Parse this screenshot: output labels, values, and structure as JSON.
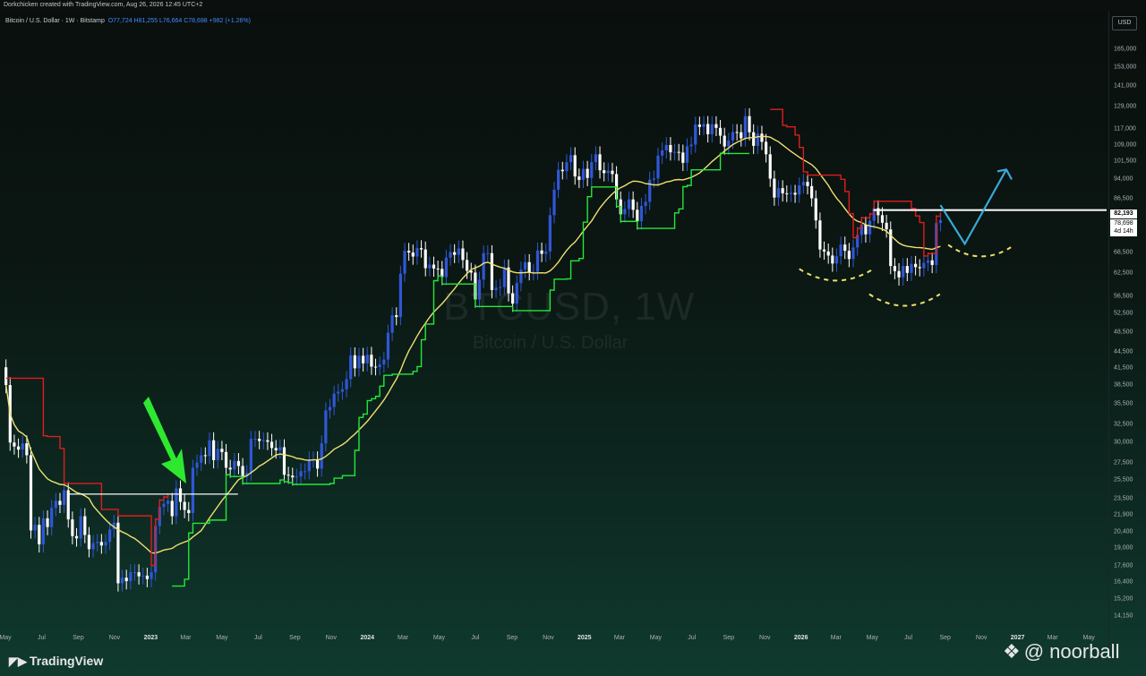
{
  "header": {
    "text": "Dorkchicken created with TradingView.com, Aug 26, 2026 12:45 UTC+2"
  },
  "symbol": {
    "title": "Bitcoin / U.S. Dollar · 1W · Bitstamp",
    "ohlc": "O77,724 H81,255 L76,664 C78,698 +982 (+1.26%)"
  },
  "watermark": {
    "ticker": "BTCUSD, 1W",
    "name": "Bitcoin / U.S. Dollar"
  },
  "axis": {
    "currency": "USD"
  },
  "price_labels": {
    "level": "82,193",
    "last": "78,698",
    "countdown": "4d 14h"
  },
  "footer": {
    "brand": "TradingView",
    "handle": "@ noorball"
  },
  "colors": {
    "bull": "#2f57d8",
    "bear": "#ffffff",
    "ma": "#f0e070",
    "support": "#22e83a",
    "resistance": "#e01d1d",
    "projection": "#3aa8d6",
    "arrow": "#2ee830"
  },
  "chart_data": {
    "type": "candlestick",
    "title": "Bitcoin / U.S. Dollar · 1W · Bitstamp",
    "y_scale": "log",
    "y_ticks": [
      14150,
      15200,
      16400,
      17600,
      19000,
      20400,
      21900,
      23500,
      25500,
      27500,
      30000,
      32500,
      35500,
      38500,
      41500,
      44500,
      48500,
      52500,
      56500,
      62500,
      68500,
      75500,
      86500,
      94000,
      101500,
      109000,
      117000,
      129000,
      141000,
      153000,
      165000
    ],
    "x_ticks": [
      "May",
      "Jul",
      "Sep",
      "Nov",
      "2023",
      "Mar",
      "May",
      "Jul",
      "Sep",
      "Nov",
      "2024",
      "Mar",
      "May",
      "Jul",
      "Sep",
      "Nov",
      "2025",
      "Mar",
      "May",
      "Jul",
      "Sep",
      "Nov",
      "2026",
      "Mar",
      "May",
      "Jul",
      "Sep",
      "Nov",
      "2027",
      "Mar",
      "May"
    ],
    "x_range": [
      "2022-05-01",
      "2027-05-31"
    ],
    "y_range": [
      13500,
      175000
    ],
    "key_levels": [
      {
        "value": 24000,
        "from": "2022-08-14",
        "to": "2023-05-28"
      },
      {
        "value": 82193,
        "from": "2026-05-03",
        "to": "2027-05-31"
      }
    ],
    "candles_weekly_close": [
      {
        "date": "2022-05-02",
        "close": 38500
      },
      {
        "date": "2022-05-09",
        "close": 30000
      },
      {
        "date": "2022-05-16",
        "close": 29500
      },
      {
        "date": "2022-05-23",
        "close": 29100
      },
      {
        "date": "2022-05-30",
        "close": 29900
      },
      {
        "date": "2022-06-06",
        "close": 28400
      },
      {
        "date": "2022-06-13",
        "close": 20500
      },
      {
        "date": "2022-06-20",
        "close": 21000
      },
      {
        "date": "2022-06-27",
        "close": 19300
      },
      {
        "date": "2022-07-04",
        "close": 21600
      },
      {
        "date": "2022-07-11",
        "close": 20800
      },
      {
        "date": "2022-07-18",
        "close": 22600
      },
      {
        "date": "2022-07-25",
        "close": 23300
      },
      {
        "date": "2022-08-01",
        "close": 22900
      },
      {
        "date": "2022-08-08",
        "close": 24400
      },
      {
        "date": "2022-08-15",
        "close": 21500
      },
      {
        "date": "2022-08-22",
        "close": 20000
      },
      {
        "date": "2022-08-29",
        "close": 19800
      },
      {
        "date": "2022-09-05",
        "close": 21800
      },
      {
        "date": "2022-09-12",
        "close": 20100
      },
      {
        "date": "2022-09-19",
        "close": 18900
      },
      {
        "date": "2022-09-26",
        "close": 19400
      },
      {
        "date": "2022-10-03",
        "close": 19500
      },
      {
        "date": "2022-10-10",
        "close": 19200
      },
      {
        "date": "2022-10-17",
        "close": 19500
      },
      {
        "date": "2022-10-24",
        "close": 20600
      },
      {
        "date": "2022-10-31",
        "close": 21200
      },
      {
        "date": "2022-11-07",
        "close": 16300
      },
      {
        "date": "2022-11-14",
        "close": 16700
      },
      {
        "date": "2022-11-21",
        "close": 16450
      },
      {
        "date": "2022-11-28",
        "close": 17100
      },
      {
        "date": "2022-12-05",
        "close": 17100
      },
      {
        "date": "2022-12-12",
        "close": 16800
      },
      {
        "date": "2022-12-19",
        "close": 16850
      },
      {
        "date": "2022-12-26",
        "close": 16600
      },
      {
        "date": "2023-01-02",
        "close": 17100
      },
      {
        "date": "2023-01-09",
        "close": 20900
      },
      {
        "date": "2023-01-16",
        "close": 22700
      },
      {
        "date": "2023-01-23",
        "close": 23000
      },
      {
        "date": "2023-01-30",
        "close": 23300
      },
      {
        "date": "2023-02-06",
        "close": 21800
      },
      {
        "date": "2023-02-13",
        "close": 24600
      },
      {
        "date": "2023-02-20",
        "close": 23200
      },
      {
        "date": "2023-02-27",
        "close": 22400
      },
      {
        "date": "2023-03-06",
        "close": 22100
      },
      {
        "date": "2023-03-13",
        "close": 26900
      },
      {
        "date": "2023-03-20",
        "close": 27500
      },
      {
        "date": "2023-03-27",
        "close": 28400
      },
      {
        "date": "2023-04-03",
        "close": 28300
      },
      {
        "date": "2023-04-10",
        "close": 30300
      },
      {
        "date": "2023-04-17",
        "close": 27800
      },
      {
        "date": "2023-04-24",
        "close": 29200
      },
      {
        "date": "2023-05-01",
        "close": 28800
      },
      {
        "date": "2023-05-08",
        "close": 26900
      },
      {
        "date": "2023-05-15",
        "close": 26700
      },
      {
        "date": "2023-05-22",
        "close": 27700
      },
      {
        "date": "2023-05-29",
        "close": 27100
      },
      {
        "date": "2023-06-05",
        "close": 25900
      },
      {
        "date": "2023-06-12",
        "close": 26300
      },
      {
        "date": "2023-06-19",
        "close": 30500
      },
      {
        "date": "2023-06-26",
        "close": 30500
      },
      {
        "date": "2023-07-03",
        "close": 30200
      },
      {
        "date": "2023-07-10",
        "close": 30300
      },
      {
        "date": "2023-07-17",
        "close": 30100
      },
      {
        "date": "2023-07-24",
        "close": 29300
      },
      {
        "date": "2023-07-31",
        "close": 29000
      },
      {
        "date": "2023-08-07",
        "close": 29400
      },
      {
        "date": "2023-08-14",
        "close": 26100
      },
      {
        "date": "2023-08-21",
        "close": 26000
      },
      {
        "date": "2023-08-28",
        "close": 25800
      },
      {
        "date": "2023-09-04",
        "close": 25900
      },
      {
        "date": "2023-09-11",
        "close": 26500
      },
      {
        "date": "2023-09-18",
        "close": 26500
      },
      {
        "date": "2023-09-25",
        "close": 27900
      },
      {
        "date": "2023-10-02",
        "close": 27900
      },
      {
        "date": "2023-10-09",
        "close": 26800
      },
      {
        "date": "2023-10-16",
        "close": 29900
      },
      {
        "date": "2023-10-23",
        "close": 34500
      },
      {
        "date": "2023-10-30",
        "close": 35000
      },
      {
        "date": "2023-11-06",
        "close": 37100
      },
      {
        "date": "2023-11-13",
        "close": 37400
      },
      {
        "date": "2023-11-20",
        "close": 37800
      },
      {
        "date": "2023-11-27",
        "close": 39500
      },
      {
        "date": "2023-12-04",
        "close": 43800
      },
      {
        "date": "2023-12-11",
        "close": 41400
      },
      {
        "date": "2023-12-18",
        "close": 43700
      },
      {
        "date": "2023-12-25",
        "close": 42300
      },
      {
        "date": "2024-01-01",
        "close": 43900
      },
      {
        "date": "2024-01-08",
        "close": 41700
      },
      {
        "date": "2024-01-15",
        "close": 41600
      },
      {
        "date": "2024-01-22",
        "close": 42100
      },
      {
        "date": "2024-01-29",
        "close": 43000
      },
      {
        "date": "2024-02-05",
        "close": 48300
      },
      {
        "date": "2024-02-12",
        "close": 52100
      },
      {
        "date": "2024-02-19",
        "close": 51700
      },
      {
        "date": "2024-02-26",
        "close": 62400
      },
      {
        "date": "2024-03-04",
        "close": 68900
      },
      {
        "date": "2024-03-11",
        "close": 68400
      },
      {
        "date": "2024-03-18",
        "close": 67200
      },
      {
        "date": "2024-03-25",
        "close": 69700
      },
      {
        "date": "2024-04-01",
        "close": 69300
      },
      {
        "date": "2024-04-08",
        "close": 63900
      },
      {
        "date": "2024-04-15",
        "close": 64900
      },
      {
        "date": "2024-04-22",
        "close": 63800
      },
      {
        "date": "2024-04-29",
        "close": 63700
      },
      {
        "date": "2024-05-06",
        "close": 61500
      },
      {
        "date": "2024-05-13",
        "close": 66900
      },
      {
        "date": "2024-05-20",
        "close": 68500
      },
      {
        "date": "2024-05-27",
        "close": 67700
      },
      {
        "date": "2024-06-03",
        "close": 69600
      },
      {
        "date": "2024-06-10",
        "close": 66200
      },
      {
        "date": "2024-06-17",
        "close": 63200
      },
      {
        "date": "2024-06-24",
        "close": 62700
      },
      {
        "date": "2024-07-01",
        "close": 55800
      },
      {
        "date": "2024-07-08",
        "close": 60800
      },
      {
        "date": "2024-07-15",
        "close": 68200
      },
      {
        "date": "2024-07-22",
        "close": 68200
      },
      {
        "date": "2024-07-29",
        "close": 58100
      },
      {
        "date": "2024-08-05",
        "close": 58700
      },
      {
        "date": "2024-08-12",
        "close": 58900
      },
      {
        "date": "2024-08-19",
        "close": 64100
      },
      {
        "date": "2024-08-26",
        "close": 57300
      },
      {
        "date": "2024-09-02",
        "close": 54800
      },
      {
        "date": "2024-09-09",
        "close": 59900
      },
      {
        "date": "2024-09-16",
        "close": 63500
      },
      {
        "date": "2024-09-23",
        "close": 65600
      },
      {
        "date": "2024-09-30",
        "close": 62800
      },
      {
        "date": "2024-10-07",
        "close": 62900
      },
      {
        "date": "2024-10-14",
        "close": 69000
      },
      {
        "date": "2024-10-21",
        "close": 68000
      },
      {
        "date": "2024-10-28",
        "close": 68700
      },
      {
        "date": "2024-11-04",
        "close": 80400
      },
      {
        "date": "2024-11-11",
        "close": 89800
      },
      {
        "date": "2024-11-18",
        "close": 97900
      },
      {
        "date": "2024-11-25",
        "close": 97300
      },
      {
        "date": "2024-12-02",
        "close": 101200
      },
      {
        "date": "2024-12-09",
        "close": 104300
      },
      {
        "date": "2024-12-16",
        "close": 95100
      },
      {
        "date": "2024-12-23",
        "close": 93700
      },
      {
        "date": "2024-12-30",
        "close": 98300
      },
      {
        "date": "2025-01-06",
        "close": 94500
      },
      {
        "date": "2025-01-13",
        "close": 101200
      },
      {
        "date": "2025-01-20",
        "close": 104700
      },
      {
        "date": "2025-01-27",
        "close": 97700
      },
      {
        "date": "2025-02-03",
        "close": 96500
      },
      {
        "date": "2025-02-10",
        "close": 97500
      },
      {
        "date": "2025-02-17",
        "close": 96100
      },
      {
        "date": "2025-02-24",
        "close": 86100
      },
      {
        "date": "2025-03-03",
        "close": 80700
      },
      {
        "date": "2025-03-10",
        "close": 82600
      },
      {
        "date": "2025-03-17",
        "close": 86100
      },
      {
        "date": "2025-03-24",
        "close": 82300
      },
      {
        "date": "2025-03-31",
        "close": 78300
      },
      {
        "date": "2025-04-07",
        "close": 83700
      },
      {
        "date": "2025-04-14",
        "close": 85200
      },
      {
        "date": "2025-04-21",
        "close": 93800
      },
      {
        "date": "2025-04-28",
        "close": 94300
      },
      {
        "date": "2025-05-05",
        "close": 104100
      },
      {
        "date": "2025-05-12",
        "close": 106500
      },
      {
        "date": "2025-05-19",
        "close": 109000
      },
      {
        "date": "2025-05-26",
        "close": 105600
      },
      {
        "date": "2025-06-02",
        "close": 105800
      },
      {
        "date": "2025-06-09",
        "close": 105500
      },
      {
        "date": "2025-06-16",
        "close": 100900
      },
      {
        "date": "2025-06-23",
        "close": 108400
      },
      {
        "date": "2025-06-30",
        "close": 109200
      },
      {
        "date": "2025-07-07",
        "close": 119100
      },
      {
        "date": "2025-07-14",
        "close": 117900
      },
      {
        "date": "2025-07-21",
        "close": 119400
      },
      {
        "date": "2025-07-28",
        "close": 114200
      },
      {
        "date": "2025-08-04",
        "close": 119300
      },
      {
        "date": "2025-08-11",
        "close": 117400
      },
      {
        "date": "2025-08-18",
        "close": 113500
      },
      {
        "date": "2025-08-25",
        "close": 108300
      },
      {
        "date": "2025-09-01",
        "close": 111100
      },
      {
        "date": "2025-09-08",
        "close": 115300
      },
      {
        "date": "2025-09-15",
        "close": 115200
      },
      {
        "date": "2025-09-22",
        "close": 112200
      },
      {
        "date": "2025-09-29",
        "close": 123500
      },
      {
        "date": "2025-10-06",
        "close": 115200
      },
      {
        "date": "2025-10-13",
        "close": 108600
      },
      {
        "date": "2025-10-20",
        "close": 114500
      },
      {
        "date": "2025-10-27",
        "close": 110500
      },
      {
        "date": "2025-11-03",
        "close": 104700
      },
      {
        "date": "2025-11-10",
        "close": 94200
      },
      {
        "date": "2025-11-17",
        "close": 86800
      },
      {
        "date": "2025-11-24",
        "close": 90400
      },
      {
        "date": "2025-12-01",
        "close": 88400
      },
      {
        "date": "2025-12-08",
        "close": 88200
      },
      {
        "date": "2025-12-15",
        "close": 88600
      },
      {
        "date": "2025-12-22",
        "close": 87900
      },
      {
        "date": "2025-12-29",
        "close": 91500
      },
      {
        "date": "2026-01-05",
        "close": 92900
      },
      {
        "date": "2026-01-12",
        "close": 91200
      },
      {
        "date": "2026-01-19",
        "close": 86500
      },
      {
        "date": "2026-01-26",
        "close": 78600
      },
      {
        "date": "2026-02-02",
        "close": 69300
      },
      {
        "date": "2026-02-09",
        "close": 68700
      },
      {
        "date": "2026-02-16",
        "close": 67500
      },
      {
        "date": "2026-02-23",
        "close": 65200
      },
      {
        "date": "2026-03-02",
        "close": 67300
      },
      {
        "date": "2026-03-09",
        "close": 70800
      },
      {
        "date": "2026-03-16",
        "close": 68900
      },
      {
        "date": "2026-03-23",
        "close": 66500
      },
      {
        "date": "2026-03-30",
        "close": 69900
      },
      {
        "date": "2026-04-06",
        "close": 73800
      },
      {
        "date": "2026-04-13",
        "close": 77200
      },
      {
        "date": "2026-04-20",
        "close": 74000
      },
      {
        "date": "2026-04-27",
        "close": 78500
      },
      {
        "date": "2026-05-04",
        "close": 82900
      },
      {
        "date": "2026-05-11",
        "close": 80400
      },
      {
        "date": "2026-05-18",
        "close": 77800
      },
      {
        "date": "2026-05-25",
        "close": 75600
      },
      {
        "date": "2026-06-01",
        "close": 64500
      },
      {
        "date": "2026-06-08",
        "close": 63100
      },
      {
        "date": "2026-06-15",
        "close": 61400
      },
      {
        "date": "2026-06-22",
        "close": 64500
      },
      {
        "date": "2026-06-29",
        "close": 62600
      },
      {
        "date": "2026-07-06",
        "close": 65100
      },
      {
        "date": "2026-07-13",
        "close": 64200
      },
      {
        "date": "2026-07-20",
        "close": 63900
      },
      {
        "date": "2026-07-27",
        "close": 65400
      },
      {
        "date": "2026-08-03",
        "close": 66100
      },
      {
        "date": "2026-08-10",
        "close": 64800
      },
      {
        "date": "2026-08-17",
        "close": 77724
      },
      {
        "date": "2026-08-24",
        "close": 78698
      }
    ]
  }
}
